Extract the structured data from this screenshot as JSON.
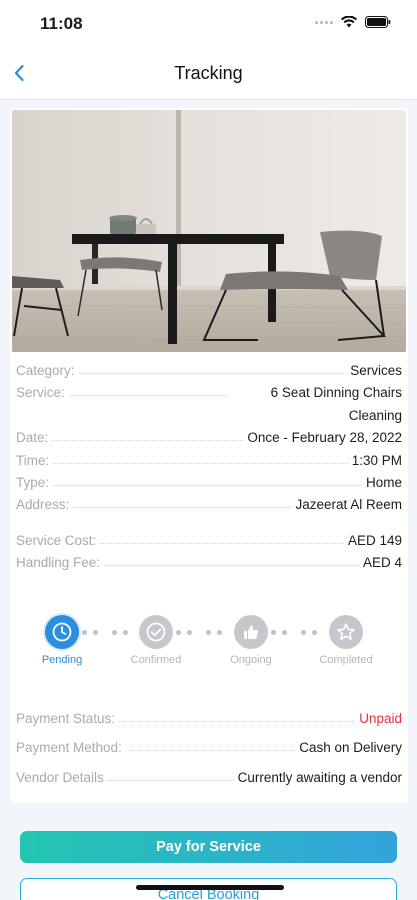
{
  "status_bar": {
    "time": "11:08"
  },
  "nav": {
    "title": "Tracking"
  },
  "details": {
    "category_label": "Category:",
    "category_value": "Services",
    "service_label": "Service:",
    "service_value": "6 Seat Dinning Chairs Cleaning",
    "date_label": "Date:",
    "date_value": "Once - February 28, 2022",
    "time_label": "Time:",
    "time_value": "1:30 PM",
    "type_label": "Type:",
    "type_value": "Home",
    "address_label": "Address:",
    "address_value": "Jazeerat Al Reem",
    "service_cost_label": "Service Cost:",
    "service_cost_value": "AED 149",
    "handling_fee_label": "Handling Fee:",
    "handling_fee_value": "AED 4"
  },
  "tracker": {
    "steps": [
      {
        "label": "Pending",
        "icon": "clock-icon",
        "active": true
      },
      {
        "label": "Confirmed",
        "icon": "check-icon",
        "active": false
      },
      {
        "label": "Ongoing",
        "icon": "thumbs-up-icon",
        "active": false
      },
      {
        "label": "Completed",
        "icon": "star-icon",
        "active": false
      }
    ]
  },
  "payment": {
    "status_label": "Payment Status:",
    "status_value": "Unpaid",
    "method_label": "Payment Method:",
    "method_value": "Cash on Delivery",
    "vendor_label": "Vendor Details",
    "vendor_value": "Currently awaiting a vendor"
  },
  "buttons": {
    "pay_label": "Pay for Service",
    "cancel_label": "Cancel Booking"
  },
  "colors": {
    "accent": "#2b8fe0",
    "unpaid": "#e8323f",
    "gradient_start": "#23c6b1",
    "gradient_end": "#33a3dc"
  }
}
